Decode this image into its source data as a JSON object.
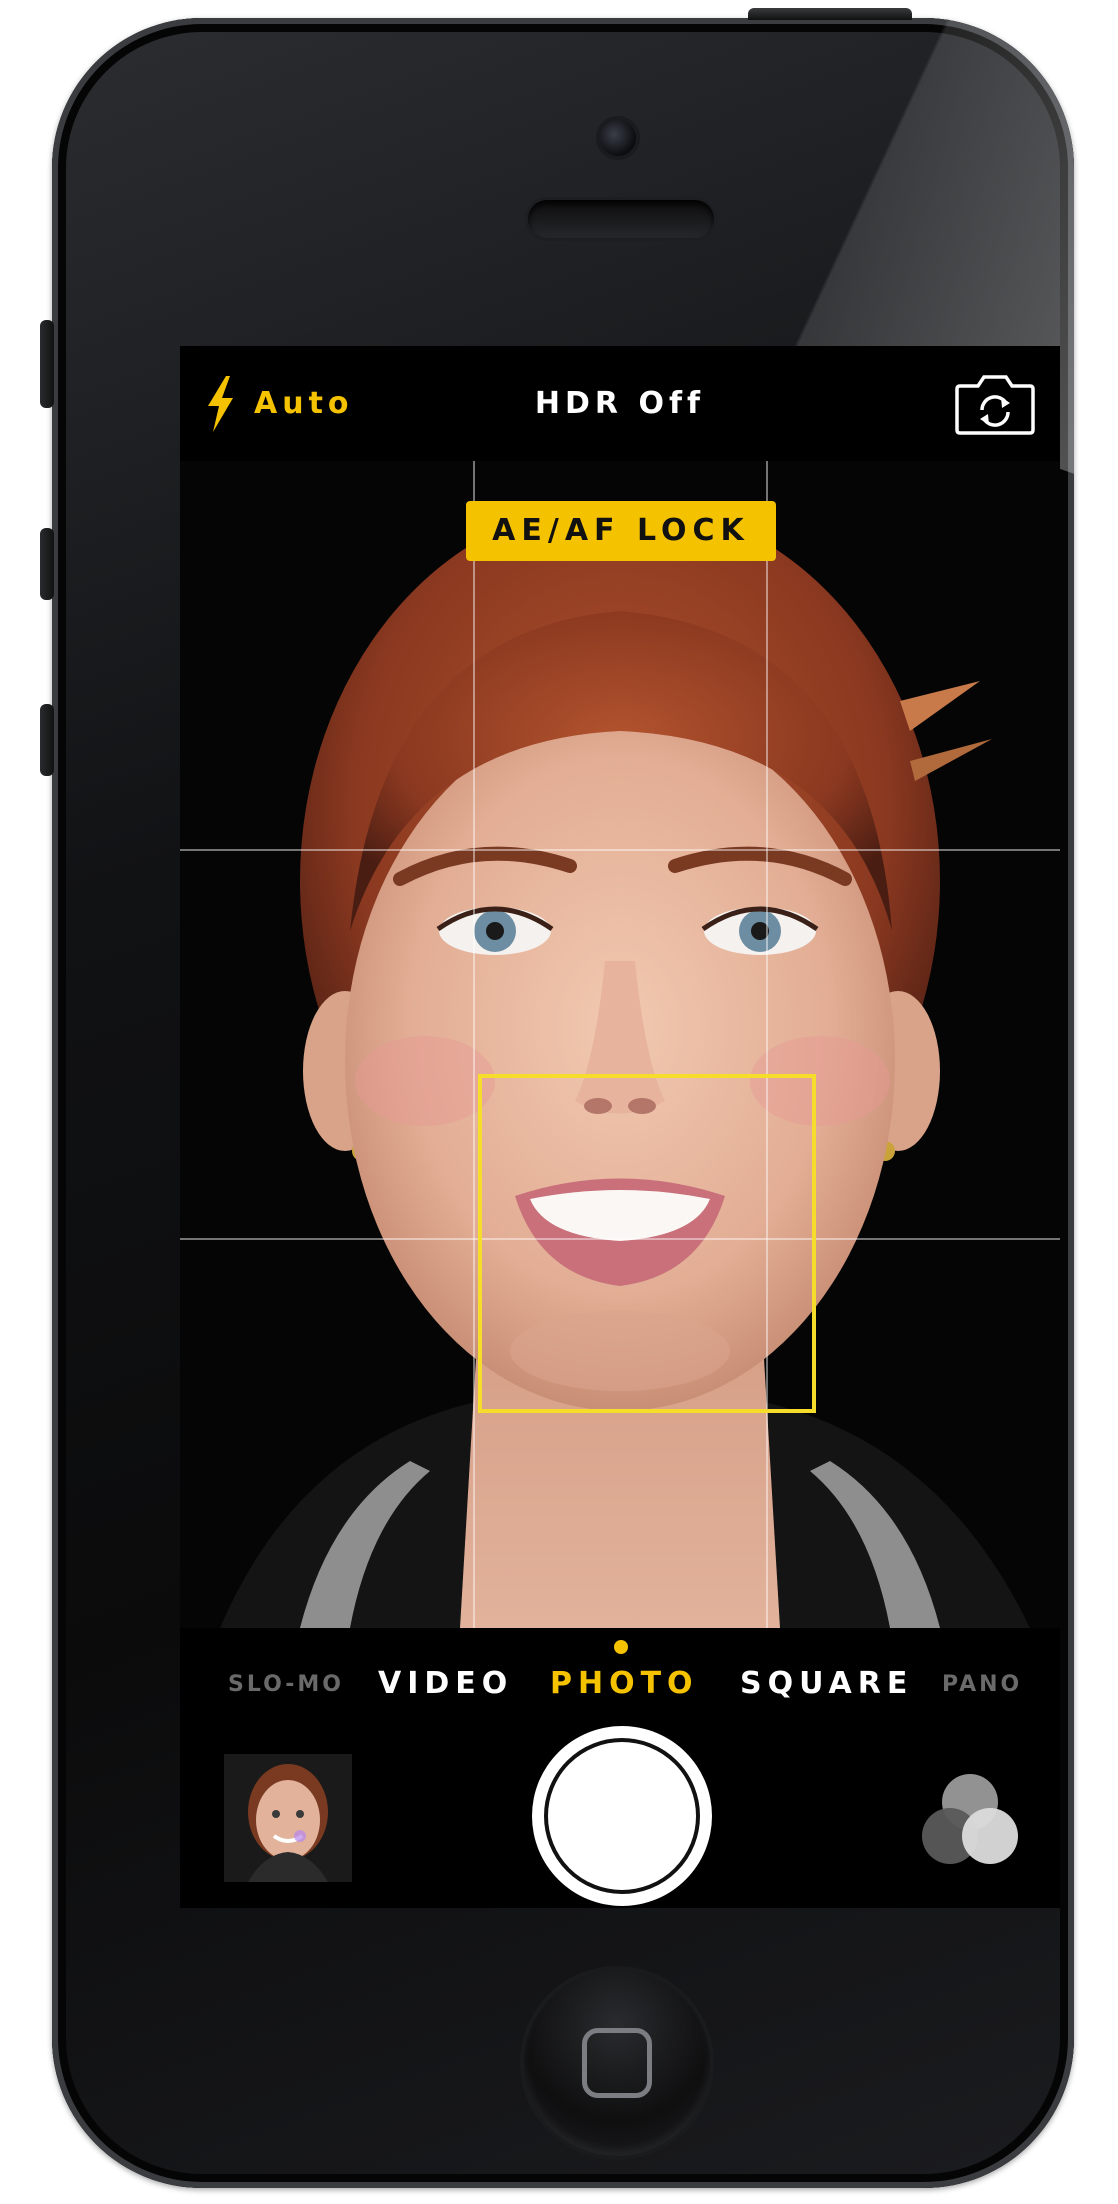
{
  "camera": {
    "top_bar": {
      "flash_label": "Auto",
      "hdr_label": "HDR Off",
      "flash_icon": "lightning-bolt-icon",
      "switch_camera_icon": "camera-rotate-icon"
    },
    "viewfinder": {
      "lock_label": "AE/AF LOCK",
      "grid": true
    },
    "modes": [
      {
        "label": "SLO-MO",
        "state": "dim"
      },
      {
        "label": "VIDEO",
        "state": "normal"
      },
      {
        "label": "PHOTO",
        "state": "active"
      },
      {
        "label": "SQUARE",
        "state": "normal"
      },
      {
        "label": "PANO",
        "state": "dim"
      }
    ],
    "controls": {
      "thumbnail_icon": "photo-thumbnail",
      "shutter_icon": "shutter-button-icon",
      "filters_icon": "filters-circles-icon"
    }
  },
  "colors": {
    "accent": "#f5c200",
    "focus_box": "#f6dd2c",
    "background": "#000000"
  }
}
